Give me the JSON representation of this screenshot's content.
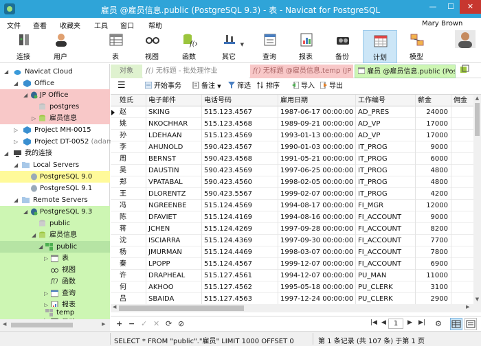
{
  "window": {
    "title": "雇员 @雇员信息.public (PostgreSQL 9.3) - 表 - Navicat for PostgreSQL",
    "minimize": "—",
    "maximize": "☐",
    "close": "✕"
  },
  "menu": {
    "items": [
      "文件",
      "查看",
      "收藏夹",
      "工具",
      "窗口",
      "帮助"
    ],
    "user": "Mary Brown"
  },
  "toolbar": {
    "items": [
      {
        "label": "连接",
        "icon": "connection-icon"
      },
      {
        "label": "用户",
        "icon": "user-icon"
      },
      {
        "label": "表",
        "icon": "table-icon"
      },
      {
        "label": "视图",
        "icon": "view-icon"
      },
      {
        "label": "函数",
        "icon": "function-icon"
      },
      {
        "label": "其它",
        "icon": "other-icon"
      },
      {
        "label": "查询",
        "icon": "query-icon"
      },
      {
        "label": "报表",
        "icon": "report-icon"
      },
      {
        "label": "备份",
        "icon": "backup-icon"
      },
      {
        "label": "计划",
        "icon": "schedule-icon"
      },
      {
        "label": "模型",
        "icon": "model-icon"
      }
    ],
    "active": "计划"
  },
  "tree": {
    "items": [
      {
        "label": "Navicat Cloud"
      },
      {
        "label": "Office"
      },
      {
        "label": "JP Office"
      },
      {
        "label": "postgres"
      },
      {
        "label": "雇员信息"
      },
      {
        "label": "Project MH-0015"
      },
      {
        "label": "Project DT-0052",
        "suffix": "(adamsn"
      },
      {
        "label": "我的连接"
      },
      {
        "label": "Local Servers"
      },
      {
        "label": "PostgreSQL 9.0"
      },
      {
        "label": "PostgreSQL 9.1"
      },
      {
        "label": "Remote Servers"
      },
      {
        "label": "PostgreSQL 9.3"
      },
      {
        "label": "public"
      },
      {
        "label": "雇员信息"
      },
      {
        "label": "public"
      },
      {
        "label": "表"
      },
      {
        "label": "视图"
      },
      {
        "label": "函数"
      },
      {
        "label": "查询"
      },
      {
        "label": "报表"
      },
      {
        "label": "备份"
      },
      {
        "label": "temp"
      }
    ]
  },
  "tabs": {
    "objects": "对象",
    "query1": "无标题 - 批处理作业",
    "query2": "无标题 @雇员信息.temp (JP ...",
    "table": "雇员 @雇员信息.public (Pos..."
  },
  "actions": {
    "begin_transaction": "开始事务",
    "memo": "备注",
    "filter": "筛选",
    "sort": "排序",
    "import": "导入",
    "export": "导出"
  },
  "grid": {
    "columns": [
      "姓氏",
      "电子邮件",
      "电话号码",
      "雇用日期",
      "工作编号",
      "薪金",
      "佣金"
    ],
    "rows": [
      [
        "赵",
        "SKING",
        "515.123.4567",
        "1987-06-17 00:00:00",
        "AD_PRES",
        "24000"
      ],
      [
        "姚",
        "NKOCHHAR",
        "515.123.4568",
        "1989-09-21 00:00:00",
        "AD_VP",
        "17000"
      ],
      [
        "孙",
        "LDEHAAN",
        "515.123.4569",
        "1993-01-13 00:00:00",
        "AD_VP",
        "17000"
      ],
      [
        "李",
        "AHUNOLD",
        "590.423.4567",
        "1990-01-03 00:00:00",
        "IT_PROG",
        "9000"
      ],
      [
        "周",
        "BERNST",
        "590.423.4568",
        "1991-05-21 00:00:00",
        "IT_PROG",
        "6000"
      ],
      [
        "吴",
        "DAUSTIN",
        "590.423.4569",
        "1997-06-25 00:00:00",
        "IT_PROG",
        "4800"
      ],
      [
        "郑",
        "VPATABAL",
        "590.423.4560",
        "1998-02-05 00:00:00",
        "IT_PROG",
        "4800"
      ],
      [
        "王",
        "DLORENTZ",
        "590.423.5567",
        "1999-02-07 00:00:00",
        "IT_PROG",
        "4200"
      ],
      [
        "冯",
        "NGREENBE",
        "515.124.4569",
        "1994-08-17 00:00:00",
        "FI_MGR",
        "12000"
      ],
      [
        "陈",
        "DFAVIET",
        "515.124.4169",
        "1994-08-16 00:00:00",
        "FI_ACCOUNT",
        "9000"
      ],
      [
        "蒋",
        "JCHEN",
        "515.124.4269",
        "1997-09-28 00:00:00",
        "FI_ACCOUNT",
        "8200"
      ],
      [
        "沈",
        "ISCIARRA",
        "515.124.4369",
        "1997-09-30 00:00:00",
        "FI_ACCOUNT",
        "7700"
      ],
      [
        "杨",
        "JMURMAN",
        "515.124.4469",
        "1998-03-07 00:00:00",
        "FI_ACCOUNT",
        "7800"
      ],
      [
        "秦",
        "LPOPP",
        "515.124.4567",
        "1999-12-07 00:00:00",
        "FI_ACCOUNT",
        "6900"
      ],
      [
        "许",
        "DRAPHEAL",
        "515.127.4561",
        "1994-12-07 00:00:00",
        "PU_MAN",
        "11000"
      ],
      [
        "何",
        "AKHOO",
        "515.127.4562",
        "1995-05-18 00:00:00",
        "PU_CLERK",
        "3100"
      ],
      [
        "吕",
        "SBAIDA",
        "515.127.4563",
        "1997-12-24 00:00:00",
        "PU_CLERK",
        "2900"
      ]
    ]
  },
  "bottom_nav": {
    "add": "+",
    "remove": "−",
    "apply": "✓",
    "cancel": "✕",
    "refresh": "⟳",
    "stop": "⊘",
    "first": "|◀",
    "prev": "◀",
    "page": "1",
    "next": "▶",
    "last": "▶|",
    "settings": "⚙"
  },
  "status": {
    "sql": "SELECT * FROM \"public\".\"雇员\" LIMIT 1000 OFFSET 0",
    "records": "第 1 条记录 (共 107 条) 于第 1 页"
  },
  "colors": {
    "titlebar": "#2fa4d8",
    "highlight_red": "#f8c8c8",
    "highlight_yellow": "#fffa9a",
    "highlight_green": "#cdf6b3"
  }
}
